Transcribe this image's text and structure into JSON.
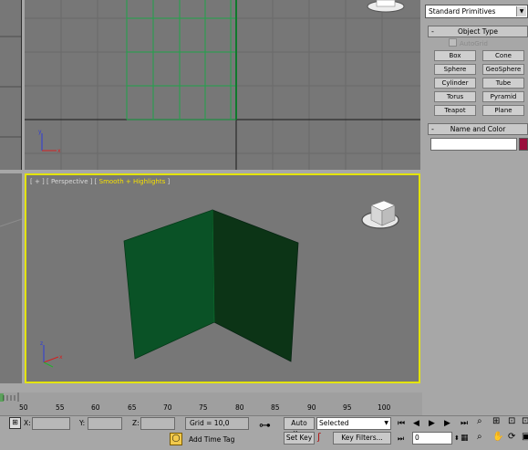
{
  "viewports": {
    "top_label": "",
    "perspective": {
      "label_prefix": "[ + ] [ Perspective ] [ ",
      "label_mode": "Smooth + Highlights",
      "label_suffix": " ]"
    }
  },
  "command_panel": {
    "category": "Standard Primitives",
    "object_type_header": "Object Type",
    "autogrid_label": "AutoGrid",
    "buttons": [
      "Box",
      "Cone",
      "Sphere",
      "GeoSphere",
      "Cylinder",
      "Tube",
      "Torus",
      "Pyramid",
      "Teapot",
      "Plane"
    ],
    "name_color_header": "Name and Color",
    "name_value": "",
    "color_swatch": "#9a0f3c"
  },
  "timeline": {
    "labels": [
      "50",
      "55",
      "60",
      "65",
      "70",
      "75",
      "80",
      "85",
      "90",
      "95",
      "100"
    ]
  },
  "status": {
    "x_label": "X:",
    "y_label": "Y:",
    "z_label": "Z:",
    "x_value": "",
    "y_value": "",
    "z_value": "",
    "grid": "Grid = 10,0",
    "add_time_tag": "Add Time Tag",
    "auto_key": "Auto Key",
    "set_key": "Set Key",
    "key_mode": "Selected",
    "key_filters": "Key Filters...",
    "frame": "0"
  },
  "colors": {
    "viewport_bg": "#777777",
    "active_border": "#e4e400",
    "plane_left": "#0a5226",
    "plane_right": "#0c3416",
    "grid_green": "#1fa34a"
  }
}
